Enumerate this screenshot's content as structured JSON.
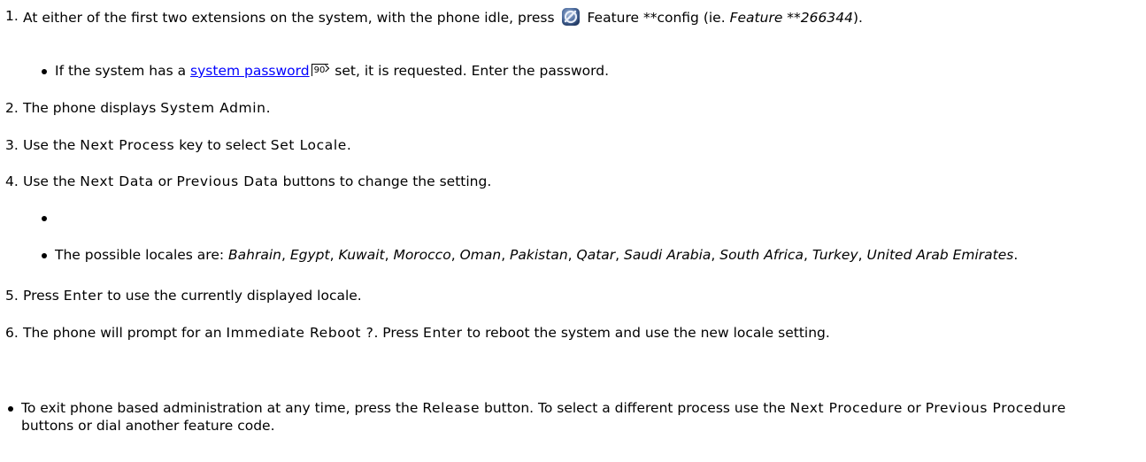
{
  "steps": [
    {
      "num": "1.",
      "part1": "At either of the first two extensions on the system, with the phone idle, press",
      "icon": "feature-button-icon",
      "part2": "Feature **config (ie.",
      "italic": "Feature **266344",
      "part3": ").",
      "sub": {
        "pre": "If the system has a",
        "link": "system password",
        "ref": "90",
        "post": "set, it is requested. Enter the password."
      }
    },
    {
      "num": "2.",
      "pre": "The phone displays",
      "mono": "System Admin",
      "post": "."
    },
    {
      "num": "3.",
      "pre": "Use the",
      "mono": "Next Process",
      "mid": "key to select",
      "mono2": "Set Locale",
      "post": "."
    },
    {
      "num": "4.",
      "pre": "Use the",
      "mono": "Next Data",
      "mid": "or",
      "mono2": "Previous Data",
      "post": "buttons to change the setting.",
      "locales_prefix": "The possible locales are:",
      "locales": [
        "Bahrain",
        "Egypt",
        "Kuwait",
        "Morocco",
        "Oman",
        "Pakistan",
        "Qatar",
        "Saudi Arabia",
        "South Africa",
        "Turkey",
        "United Arab Emirates"
      ]
    },
    {
      "num": "5.",
      "pre": "Press",
      "mono": "Enter",
      "post": "to use the currently displayed locale."
    },
    {
      "num": "6.",
      "pre": "The phone will prompt for an",
      "mono": "Immediate Reboot ?",
      "mid": ". Press",
      "mono2": "Enter",
      "post": "to reboot the system and use the new locale setting."
    }
  ],
  "note": {
    "pre": "To exit phone based administration at any time, press the",
    "mono": "Release",
    "mid": "button. To select a different process use the",
    "mono2": "Next Procedure",
    "mid2": "or",
    "mono3": "Previous Procedure",
    "post": "buttons or dial another feature code."
  }
}
